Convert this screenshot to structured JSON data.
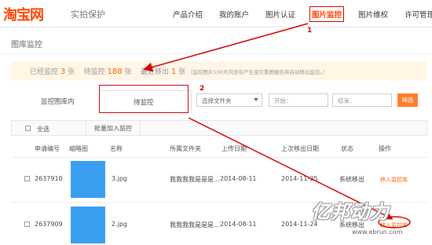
{
  "header": {
    "logo": "淘宝网",
    "logo_sub": "实拍保护",
    "nav": [
      {
        "label": "产品介绍"
      },
      {
        "label": "我的账户"
      },
      {
        "label": "图片认证"
      },
      {
        "label": "图片监控"
      },
      {
        "label": "图片维权"
      },
      {
        "label": "许可管理"
      }
    ]
  },
  "section_title": "图库监控",
  "stats": {
    "monitored_label": "已经监控",
    "monitored_count": "3",
    "monitored_unit": "张",
    "pending_label": "待监控",
    "pending_count": "188",
    "pending_unit": "张",
    "recent_label": "最近移出",
    "recent_count": "1",
    "recent_unit": "张",
    "note": "（监控图片100天内没有产生宝贝重图报告将自动移出监控。）"
  },
  "filter": {
    "tab_monitored": "监控图库内",
    "tab_pending": "待监控",
    "folder_select": "选择文件夹",
    "start_placeholder": "开始：",
    "end_placeholder": "结束：",
    "filter_button": "筛选"
  },
  "bulk": {
    "select_all": "全选",
    "add_button": "批量加入监控"
  },
  "table": {
    "headers": [
      "申请编号",
      "缩略图",
      "名称",
      "所属文件夹",
      "上传日期",
      "上次移出日期",
      "状态",
      "操作"
    ],
    "rows": [
      {
        "id": "2637910",
        "name": "3.jpg",
        "folder": "我我我我是是是...",
        "upload": "2014-08-11",
        "removed": "2014-11-25",
        "status": "系统移出",
        "action": "移入监控库"
      },
      {
        "id": "2637909",
        "name": "2.jpg",
        "folder": "我我我我是是是...",
        "upload": "2014-08-11",
        "removed": "2014-11-24",
        "status": "系统移出",
        "action": "移入监控库"
      }
    ]
  },
  "annotations": {
    "one": "1",
    "two": "2"
  },
  "watermark": {
    "title": "亿邦动力",
    "url": "www.ebrun.com"
  },
  "colors": {
    "brand": "#ff4400",
    "accent": "#ff6600",
    "annotation": "#d40000",
    "stats_bg": "#fff6e6",
    "thumb": "#3a9ff0"
  }
}
